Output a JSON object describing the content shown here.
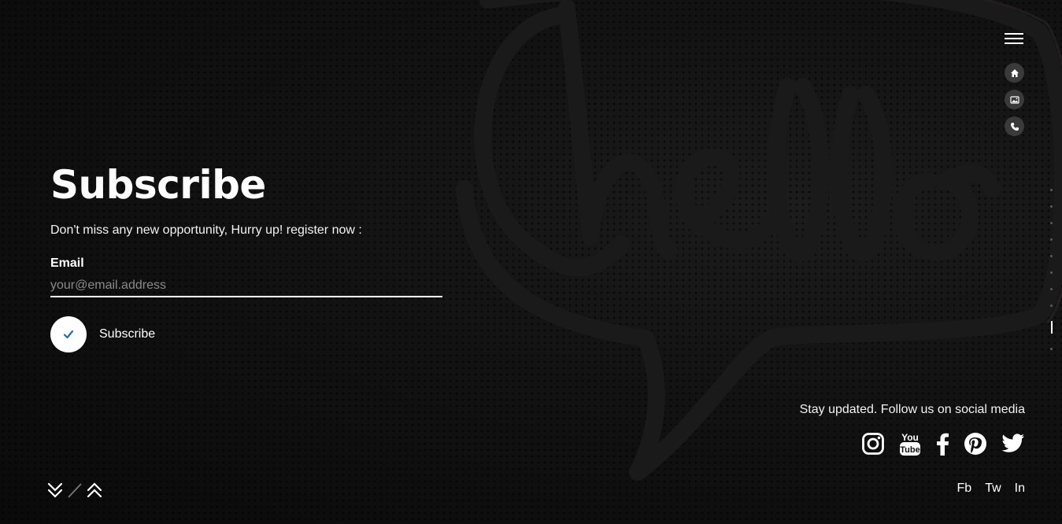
{
  "page": {
    "title": "Subscribe",
    "subtitle": "Don't miss any new opportunity, Hurry up! register now :"
  },
  "form": {
    "email_label": "Email",
    "email_placeholder": "your@email.address",
    "email_value": "",
    "submit_label": "Subscribe"
  },
  "nav": {
    "menu_icon": "hamburger-icon",
    "quick_links": [
      {
        "icon": "home-icon"
      },
      {
        "icon": "image-icon"
      },
      {
        "icon": "phone-icon"
      }
    ],
    "section_dots": 10,
    "active_section_index": 8
  },
  "social": {
    "text": "Stay updated. Follow us on social media",
    "icons": [
      "instagram-icon",
      "youtube-icon",
      "facebook-icon",
      "pinterest-icon",
      "twitter-icon"
    ],
    "links": [
      "Fb",
      "Tw",
      "In"
    ]
  },
  "colors": {
    "background": "#0f0f0f",
    "text": "#ffffff",
    "accent": "#1e6fc1",
    "muted": "#8a8a8a"
  }
}
